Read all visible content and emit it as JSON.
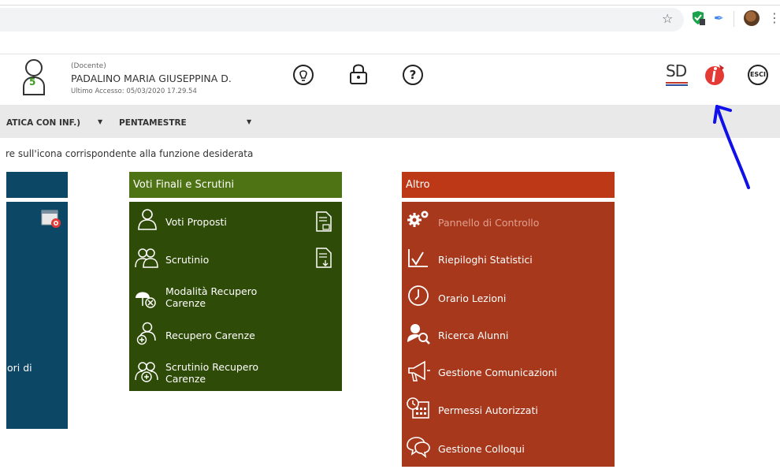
{
  "browser": {
    "toolbar": {
      "star_label": "☆",
      "kebab_label": "⋮"
    }
  },
  "header": {
    "role": "(Docente)",
    "user_name": "PADALINO MARIA GIUSEPPINA D.",
    "last_access": "Ultimo Accesso: 05/03/2020 17.29.54",
    "avatar_number": "5",
    "logo_text": "SD",
    "exit_label": "ESCI"
  },
  "ribbon": {
    "class_label": "ATICA CON INF.)",
    "class_caret": "▼",
    "period_label": "PENTAMESTRE",
    "period_caret": "▼"
  },
  "instruction": "re sull'icona corrispondente alla funzione desiderata",
  "panels": {
    "left": {
      "partial_text": "ori di"
    },
    "voti": {
      "title": "Voti Finali e Scrutini",
      "items": [
        {
          "label": "Voti Proposti"
        },
        {
          "label": "Scrutinio"
        },
        {
          "label": "Modalità Recupero\nCarenze"
        },
        {
          "label": "Recupero Carenze"
        },
        {
          "label": "Scrutinio Recupero\nCarenze"
        }
      ]
    },
    "altro": {
      "title": "Altro",
      "items": [
        {
          "label": "Pannello di Controllo"
        },
        {
          "label": "Riepiloghi Statistici"
        },
        {
          "label": "Orario Lezioni"
        },
        {
          "label": "Ricerca Alunni"
        },
        {
          "label": "Gestione Comunicazioni"
        },
        {
          "label": "Permessi Autorizzati"
        },
        {
          "label": "Gestione Colloqui"
        }
      ]
    }
  },
  "colors": {
    "left_panel": "#0d4766",
    "voti_head": "#4e7314",
    "voti_body": "#2f4b08",
    "altro_head": "#bc3816",
    "altro_body": "#a8381c",
    "annotation_arrow": "#1010e8"
  }
}
